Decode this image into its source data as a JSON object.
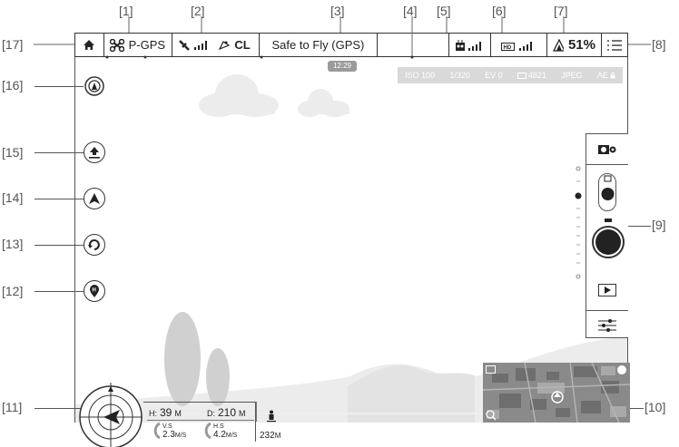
{
  "callouts": [
    "[1]",
    "[2]",
    "[3]",
    "[4]",
    "[5]",
    "[6]",
    "[7]",
    "[8]",
    "[9]",
    "[10]",
    "[11]",
    "[12]",
    "[13]",
    "[14]",
    "[15]",
    "[16]",
    "[17]"
  ],
  "topbar": {
    "flight_mode": "P-GPS",
    "gps_label": "CL",
    "status": "Safe to Fly (GPS)",
    "time": "12:29",
    "battery": "51%",
    "hd_label": "HD"
  },
  "camera": {
    "iso": "ISO 100",
    "shutter": "1/320",
    "ev": "EV 0",
    "capacity": "4821",
    "format": "JPEG",
    "ae": "AE"
  },
  "telemetry": {
    "h_label": "H:",
    "h_value": "39",
    "h_unit": "M",
    "d_label": "D:",
    "d_value": "210",
    "d_unit": "M",
    "vs_label": "V.S",
    "vs_value": "2.3",
    "vs_unit": "M/S",
    "hs_label": "H.S",
    "hs_value": "4.2",
    "hs_unit": "M/S",
    "dist_value": "232",
    "dist_unit": "M"
  },
  "icons": [
    "home-icon",
    "aircraft-icon",
    "satellite-icon",
    "gps-icon",
    "remote-signal-icon",
    "hd-signal-icon",
    "battery-icon",
    "menu-icon",
    "camera-settings-icon",
    "photo-mode-icon",
    "shutter-button-icon",
    "playback-icon",
    "camera-params-icon",
    "map-expand-icon",
    "compass-icon",
    "zoom-icon",
    "takeoff-icon",
    "intelligent-flight-icon",
    "return-home-icon",
    "waypoint-icon",
    "beacon-icon"
  ]
}
